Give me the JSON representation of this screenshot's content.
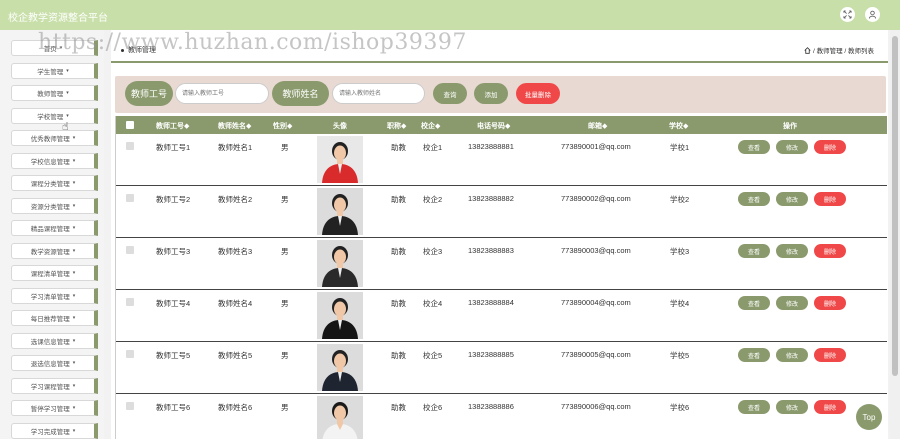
{
  "app": {
    "title": "校企教学资源整合平台"
  },
  "watermark": "https://www.huzhan.com/ishop39397",
  "sidebar": {
    "items": [
      {
        "label": "首页"
      },
      {
        "label": "学生管理"
      },
      {
        "label": "教师管理"
      },
      {
        "label": "学校管理"
      },
      {
        "label": "优秀教师管理"
      },
      {
        "label": "学校信息管理"
      },
      {
        "label": "课程分类管理"
      },
      {
        "label": "资源分类管理"
      },
      {
        "label": "精品课程管理"
      },
      {
        "label": "教学资源管理"
      },
      {
        "label": "课程清单管理"
      },
      {
        "label": "学习清单管理"
      },
      {
        "label": "每日推荐管理"
      },
      {
        "label": "选课信息管理"
      },
      {
        "label": "退选信息管理"
      },
      {
        "label": "学习课程管理"
      },
      {
        "label": "暂停学习管理"
      },
      {
        "label": "学习完成管理"
      }
    ],
    "arrow": "▾"
  },
  "breadcrumb": {
    "left": "教师管理",
    "right": "/ 教师管理 / 教师列表"
  },
  "search": {
    "label_no": "教师工号",
    "placeholder_no": "请输入教师工号",
    "label_name": "教师姓名",
    "placeholder_name": "请输入教师姓名",
    "query": "查询",
    "add": "添加",
    "batch_delete": "批量删除"
  },
  "table": {
    "headers": {
      "no": "教师工号◆",
      "name": "教师姓名◆",
      "gender": "性别◆",
      "avatar": "头像",
      "title": "职称◆",
      "campus": "校企◆",
      "phone": "电话号码◆",
      "email": "邮箱◆",
      "school": "学校◆",
      "ops": "操作"
    },
    "rows": [
      {
        "no": "教师工号1",
        "name": "教师姓名1",
        "gender": "男",
        "title": "助教",
        "campus": "校企1",
        "phone": "13823888881",
        "email": "773890001@qq.com",
        "school": "学校1"
      },
      {
        "no": "教师工号2",
        "name": "教师姓名2",
        "gender": "男",
        "title": "助教",
        "campus": "校企2",
        "phone": "13823888882",
        "email": "773890002@qq.com",
        "school": "学校2"
      },
      {
        "no": "教师工号3",
        "name": "教师姓名3",
        "gender": "男",
        "title": "助教",
        "campus": "校企3",
        "phone": "13823888883",
        "email": "773890003@qq.com",
        "school": "学校3"
      },
      {
        "no": "教师工号4",
        "name": "教师姓名4",
        "gender": "男",
        "title": "助教",
        "campus": "校企4",
        "phone": "13823888884",
        "email": "773890004@qq.com",
        "school": "学校4"
      },
      {
        "no": "教师工号5",
        "name": "教师姓名5",
        "gender": "男",
        "title": "助教",
        "campus": "校企5",
        "phone": "13823888885",
        "email": "773890005@qq.com",
        "school": "学校5"
      },
      {
        "no": "教师工号6",
        "name": "教师姓名6",
        "gender": "男",
        "title": "助教",
        "campus": "校企6",
        "phone": "13823888886",
        "email": "773890006@qq.com",
        "school": "学校6"
      }
    ],
    "actions": {
      "view": "查看",
      "edit": "修改",
      "delete": "删除"
    }
  },
  "back_to_top": "Top",
  "icons": {
    "fullscreen": "fullscreen-icon",
    "user": "user-icon",
    "home": "home-icon"
  },
  "colors": {
    "accent": "#8a9a6d",
    "topbar": "#c8dfa9",
    "danger": "#f04848",
    "search_bg": "#e8d9d2"
  }
}
